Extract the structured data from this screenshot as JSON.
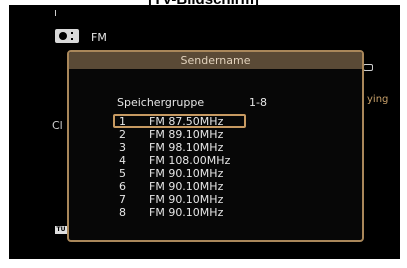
{
  "header": {
    "text": "[TV-Bildschirm]"
  },
  "source": {
    "label": "FM",
    "icon": "radio-icon"
  },
  "background": {
    "left_text": "Cl",
    "right_text": "ying",
    "badge": "TU"
  },
  "dialog": {
    "title": "Sendername",
    "group_label": "Speichergruppe",
    "group_value": "1-8",
    "presets": [
      {
        "num": "1",
        "freq": "FM 87.50MHz",
        "selected": true
      },
      {
        "num": "2",
        "freq": "FM 89.10MHz"
      },
      {
        "num": "3",
        "freq": "FM 98.10MHz"
      },
      {
        "num": "4",
        "freq": "FM 108.00MHz"
      },
      {
        "num": "5",
        "freq": "FM 90.10MHz"
      },
      {
        "num": "6",
        "freq": "FM 90.10MHz"
      },
      {
        "num": "7",
        "freq": "FM 90.10MHz"
      },
      {
        "num": "8",
        "freq": "FM 90.10MHz"
      }
    ]
  },
  "colors": {
    "screen_background": "#000000",
    "dialog_border": "#a9875a",
    "dialog_title_bar": "#5a4a36",
    "selection_outline": "#c79a62",
    "text": "#e6e6e6"
  }
}
